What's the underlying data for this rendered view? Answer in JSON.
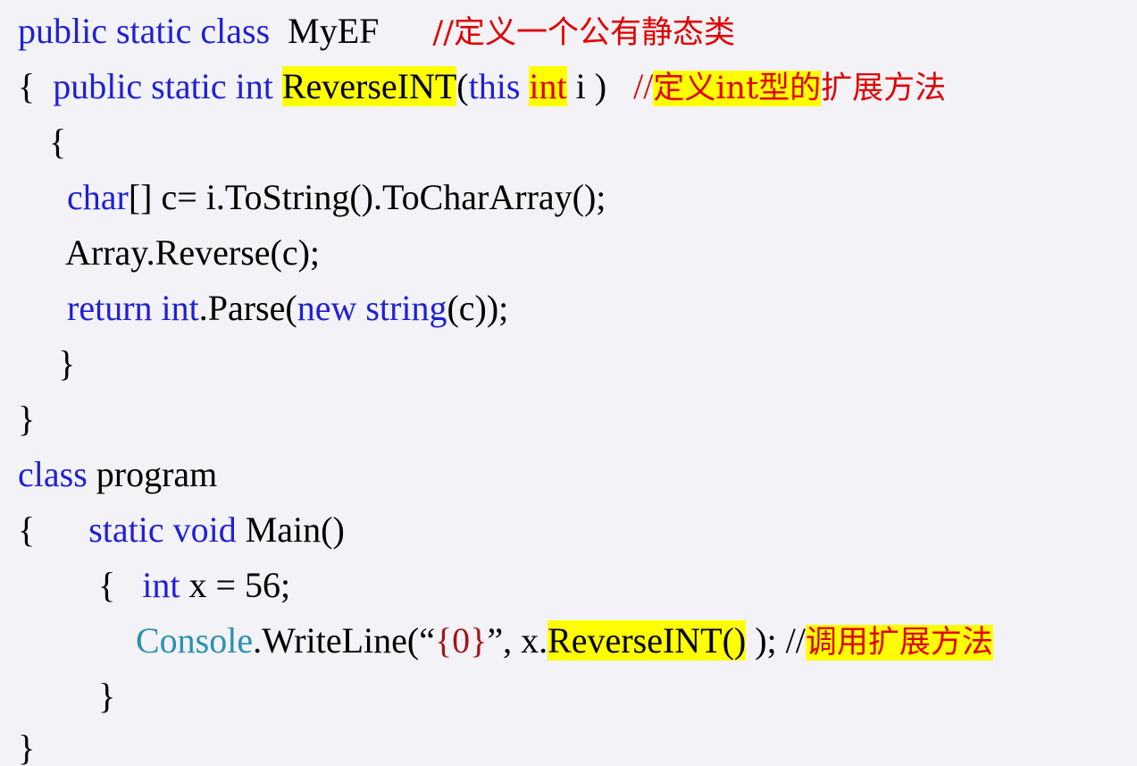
{
  "code": {
    "l1": {
      "p1": "public static class",
      "p2": "  MyEF      ",
      "cmt": "//定义一个公有静态类"
    },
    "l2": {
      "brace": "{  ",
      "kw1": "public static int ",
      "name": "ReverseINT",
      "paren": "(",
      "kw2": "this ",
      "type": "int",
      "rest": " i )   ",
      "slashes": "//",
      "cmt": "定义int型的",
      "cmt2": "扩展方法"
    },
    "l3": {
      "text": "{"
    },
    "l4": {
      "kw": "char",
      "rest": "[] c= i.ToString().ToCharArray();"
    },
    "l5": {
      "text": "Array.Reverse(c);"
    },
    "l6": {
      "kw1": "return int",
      "p1": ".Parse(",
      "kw2": "new string",
      "p2": "(c));"
    },
    "l7": {
      "text": "}"
    },
    "l8": {
      "text": "}"
    },
    "l9": {
      "kw": "class",
      "rest": " program"
    },
    "l10": {
      "brace": "{      ",
      "kw": "static void",
      "rest": " Main()"
    },
    "l11": {
      "brace": "{   ",
      "kw": "int",
      "rest": " x = 56;"
    },
    "l12": {
      "cls": "Console",
      "p1": ".WriteLine(“",
      "str": "{0}",
      "p2": "”, x.",
      "call": "ReverseINT()",
      "p3": " ); //",
      "cmt": "调用扩展方法"
    },
    "l13": {
      "text": "}"
    },
    "l14": {
      "text": "}"
    }
  }
}
